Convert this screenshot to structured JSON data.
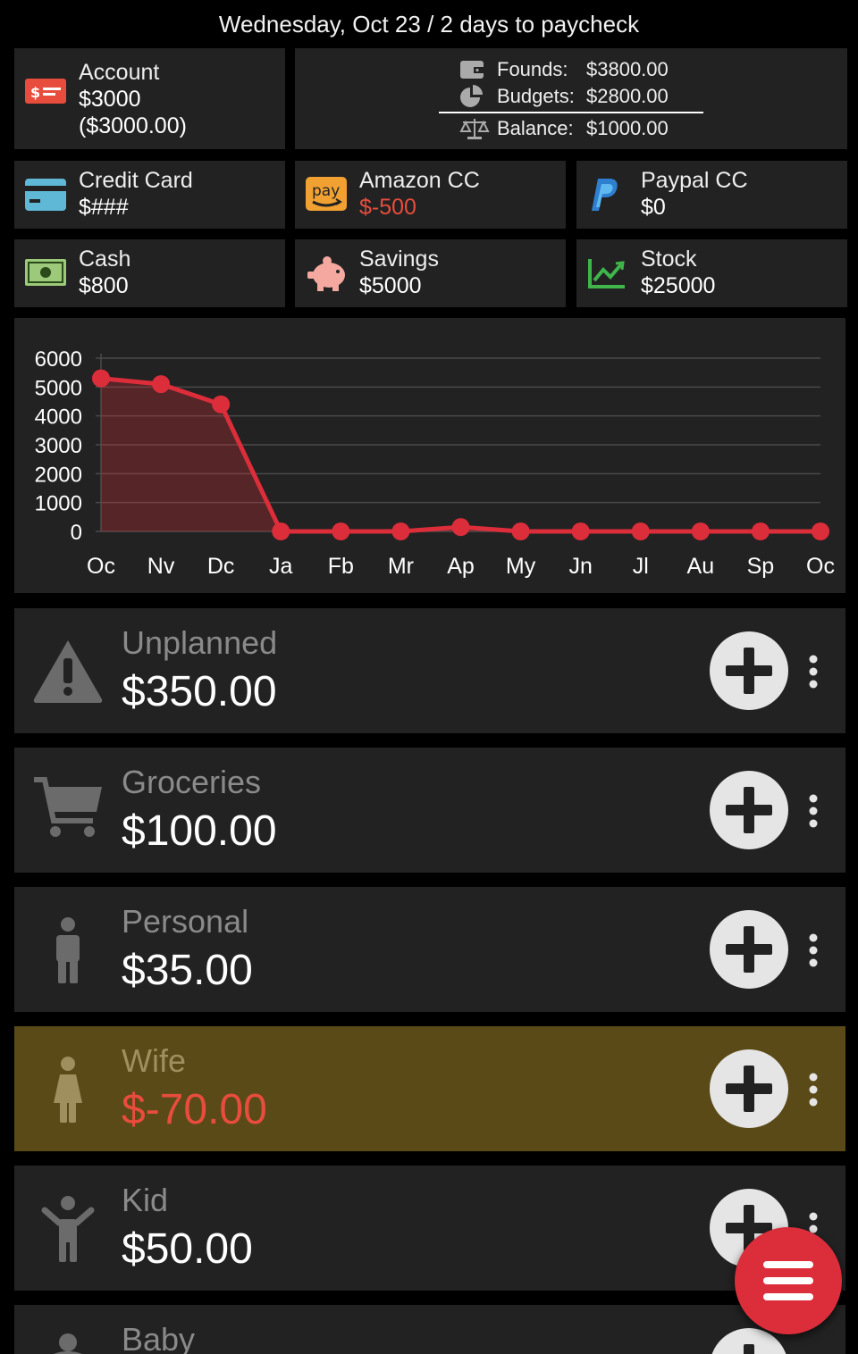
{
  "header": {
    "title": "Wednesday, Oct 23 / 2 days to paycheck"
  },
  "account": {
    "label": "Account",
    "value": "$3000",
    "sub": "($3000.00)"
  },
  "summary": {
    "founds_label": "Founds:",
    "founds_value": "$3800.00",
    "budgets_label": "Budgets:",
    "budgets_value": "$2800.00",
    "balance_label": "Balance:",
    "balance_value": "$1000.00"
  },
  "accounts": [
    {
      "label": "Credit Card",
      "value": "$###",
      "icon": "credit-card-icon"
    },
    {
      "label": "Amazon CC",
      "value": "$-500",
      "icon": "amazon-pay-icon",
      "negative": true
    },
    {
      "label": "Paypal CC",
      "value": "$0",
      "icon": "paypal-icon"
    },
    {
      "label": "Cash",
      "value": "$800",
      "icon": "cash-icon"
    },
    {
      "label": "Savings",
      "value": "$5000",
      "icon": "piggy-bank-icon"
    },
    {
      "label": "Stock",
      "value": "$25000",
      "icon": "stock-chart-icon"
    }
  ],
  "chart_data": {
    "type": "line",
    "categories": [
      "Oc",
      "Nv",
      "Dc",
      "Ja",
      "Fb",
      "Mr",
      "Ap",
      "My",
      "Jn",
      "Jl",
      "Au",
      "Sp",
      "Oc"
    ],
    "values": [
      5300,
      5100,
      4400,
      0,
      0,
      0,
      150,
      0,
      0,
      0,
      0,
      0,
      0
    ],
    "ylim": [
      0,
      6000
    ],
    "yticks": [
      "6000",
      "5000",
      "4000",
      "3000",
      "2000",
      "1000",
      "0"
    ],
    "grid": true,
    "color": "#dc2d3a"
  },
  "budgets": [
    {
      "name": "Unplanned",
      "amount": "$350.00",
      "icon": "warning-icon"
    },
    {
      "name": "Groceries",
      "amount": "$100.00",
      "icon": "cart-icon"
    },
    {
      "name": "Personal",
      "amount": "$35.00",
      "icon": "man-icon"
    },
    {
      "name": "Wife",
      "amount": "$-70.00",
      "icon": "woman-icon",
      "negative": true
    },
    {
      "name": "Kid",
      "amount": "$50.00",
      "icon": "child-icon"
    },
    {
      "name": "Baby",
      "amount": "",
      "icon": "baby-icon"
    }
  ],
  "colors": {
    "accent": "#dc2d3a",
    "negative": "#e84c3d",
    "panel": "#222222",
    "wife_highlight": "#5a4a18"
  }
}
